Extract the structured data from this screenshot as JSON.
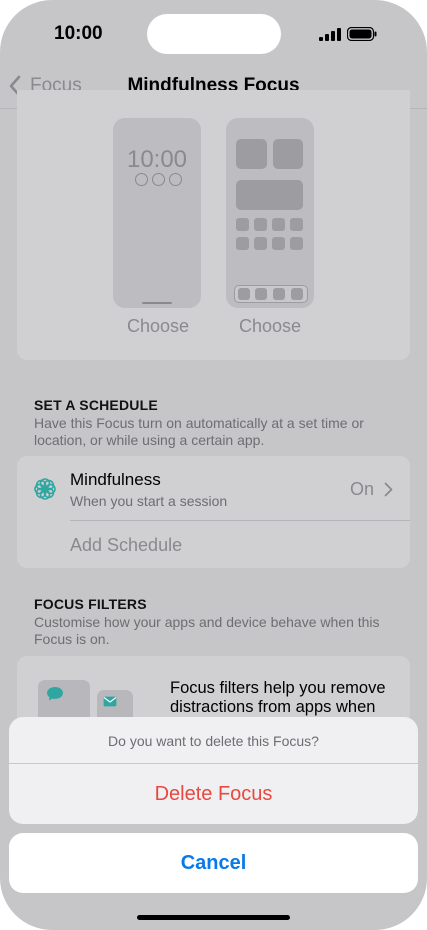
{
  "status_bar": {
    "time": "10:00"
  },
  "nav": {
    "back_label": "Focus",
    "title": "Mindfulness Focus"
  },
  "preview": {
    "lock_time": "10:00",
    "choose_lock": "Choose",
    "choose_home": "Choose"
  },
  "schedule": {
    "header": "SET A SCHEDULE",
    "description": "Have this Focus turn on automatically at a set time or location, or while using a certain app.",
    "row_title": "Mindfulness",
    "row_subtitle": "When you start a session",
    "row_value": "On",
    "add_label": "Add Schedule"
  },
  "filters": {
    "header": "FOCUS FILTERS",
    "description": "Customise how your apps and device behave when this Focus is on.",
    "body_text": "Focus filters help you remove distractions from apps when"
  },
  "action_sheet": {
    "message": "Do you want to delete this Focus?",
    "delete_label": "Delete Focus",
    "cancel_label": "Cancel"
  },
  "colors": {
    "destructive": "#e8483f",
    "accent": "#0a7ae8",
    "mindfulness_icon": "#2fa7a0"
  }
}
